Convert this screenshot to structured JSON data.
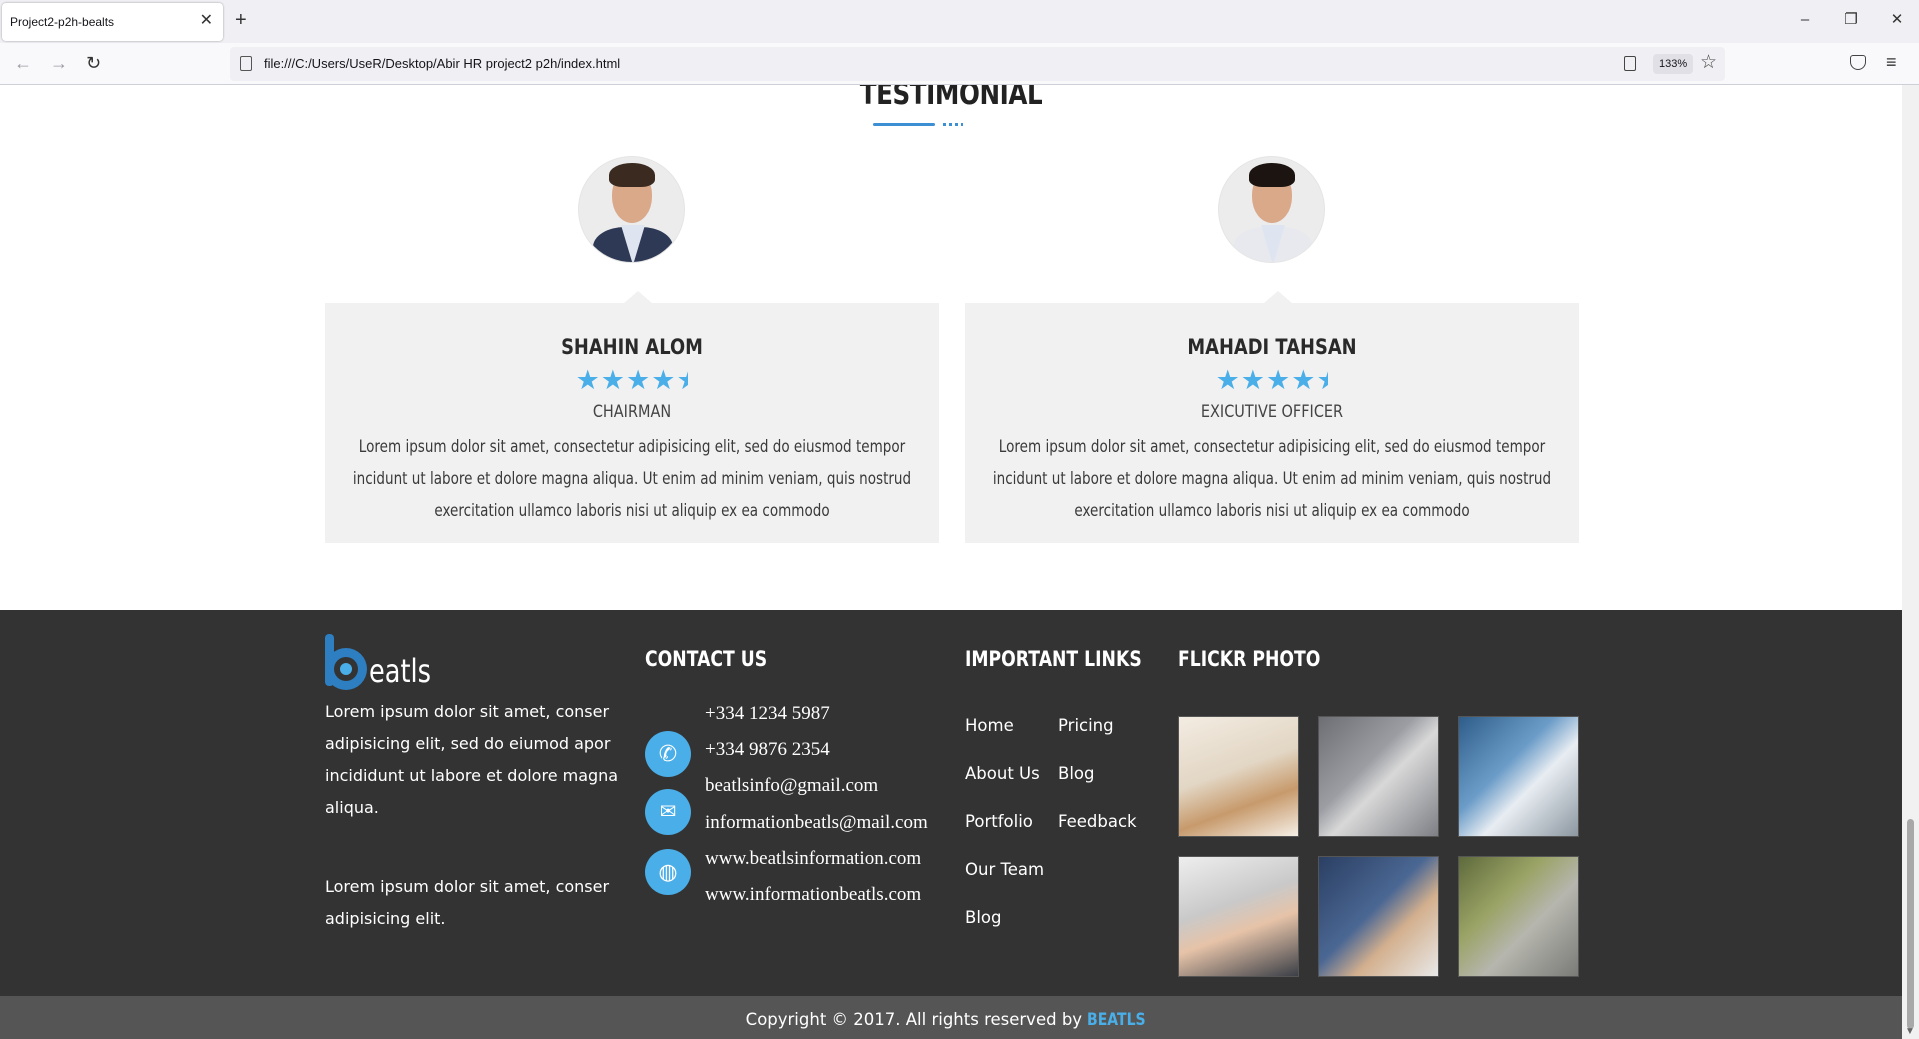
{
  "browser": {
    "tab_title": "Project2-p2h-bealts",
    "tab_close": "✕",
    "new_tab": "+",
    "url": "file:///C:/Users/UseR/Desktop/Abir HR project2 p2h/index.html",
    "zoom": "133%"
  },
  "testimonial": {
    "title": "TESTIMONIAL",
    "items": [
      {
        "name": "SHAHIN ALOM",
        "rating": 4.5,
        "role": "CHAIRMAN",
        "text": "Lorem ipsum dolor sit amet, consectetur adipisicing elit, sed do eiusmod tempor incidunt ut labore et dolore magna aliqua. Ut enim ad minim veniam, quis nostrud exercitation ullamco laboris nisi ut aliquip ex ea commodo"
      },
      {
        "name": "MAHADI TAHSAN",
        "rating": 4.5,
        "role": "EXICUTIVE OFFICER",
        "text": "Lorem ipsum dolor sit amet, consectetur adipisicing elit, sed do eiusmod tempor incidunt ut labore et dolore magna aliqua. Ut enim ad minim veniam, quis nostrud exercitation ullamco laboris nisi ut aliquip ex ea commodo"
      }
    ]
  },
  "footer": {
    "logo_text": "eatls",
    "about_1": "Lorem ipsum dolor sit amet, conser adipisicing elit, sed do eiumod apor incididunt ut labore et dolore magna aliqua.",
    "about_2": "Lorem ipsum dolor sit amet, conser adipisicing elit.",
    "contact_heading": "CONTACT US",
    "phone_1": "+334 1234 5987",
    "phone_2": "+334 9876 2354",
    "email_1": "beatlsinfo@gmail.com",
    "email_2": "informationbeatls@mail.com",
    "web_1": "www.beatlsinformation.com",
    "web_2": "www.informationbeatls.com",
    "links_heading": "IMPORTANT LINKS",
    "links_col1": [
      "Home",
      "About Us",
      "Portfolio",
      "Our Team",
      "Blog"
    ],
    "links_col2": [
      "Pricing",
      "Blog",
      "Feedback"
    ],
    "flickr_heading": "FLICKR PHOTO",
    "copyright_prefix": "Copyright © 2017. All rights reserved by",
    "copyright_brand": "BEATLS"
  },
  "colors": {
    "accent": "#4aaee8",
    "footer_bg": "#333333",
    "bottom_bar_bg": "#555555",
    "card_bg": "#f1f1f1"
  }
}
